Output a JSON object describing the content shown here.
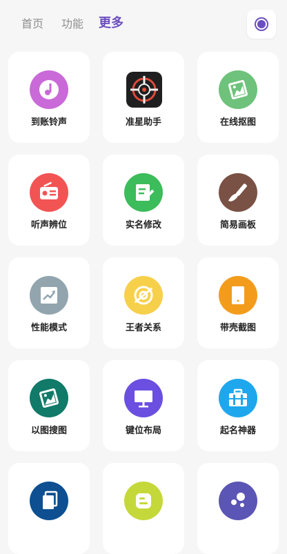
{
  "tabs": [
    {
      "label": "首页",
      "active": false
    },
    {
      "label": "功能",
      "active": false
    },
    {
      "label": "更多",
      "active": true
    }
  ],
  "record_button": {
    "icon": "record-icon",
    "color": "#6b4fbf"
  },
  "items": [
    {
      "label": "到账铃声",
      "icon": "music-note-icon",
      "color": "#c96ad8"
    },
    {
      "label": "准星助手",
      "icon": "crosshair-icon",
      "color": "#1f1f1f"
    },
    {
      "label": "在线抠图",
      "icon": "image-cutout-icon",
      "color": "#6ec27b"
    },
    {
      "label": "听声辨位",
      "icon": "radio-icon",
      "color": "#f25454"
    },
    {
      "label": "实名修改",
      "icon": "edit-document-icon",
      "color": "#3cbc5a"
    },
    {
      "label": "简易画板",
      "icon": "paint-brush-icon",
      "color": "#7a5145"
    },
    {
      "label": "性能模式",
      "icon": "trending-chart-icon",
      "color": "#92a5ae"
    },
    {
      "label": "王者关系",
      "icon": "target-link-icon",
      "color": "#f7d04b"
    },
    {
      "label": "带壳截图",
      "icon": "phone-frame-icon",
      "color": "#f39c1c"
    },
    {
      "label": "以图搜图",
      "icon": "image-search-icon",
      "color": "#117a68"
    },
    {
      "label": "键位布局",
      "icon": "monitor-icon",
      "color": "#6b4fe0"
    },
    {
      "label": "起名神器",
      "icon": "briefcase-icon",
      "color": "#1fa7ee"
    },
    {
      "label": "",
      "icon": "copy-icon",
      "color": "#0d4f91"
    },
    {
      "label": "",
      "icon": "blogger-icon",
      "color": "#c5d83a"
    },
    {
      "label": "",
      "icon": "bubbles-icon",
      "color": "#5b55b5"
    }
  ]
}
